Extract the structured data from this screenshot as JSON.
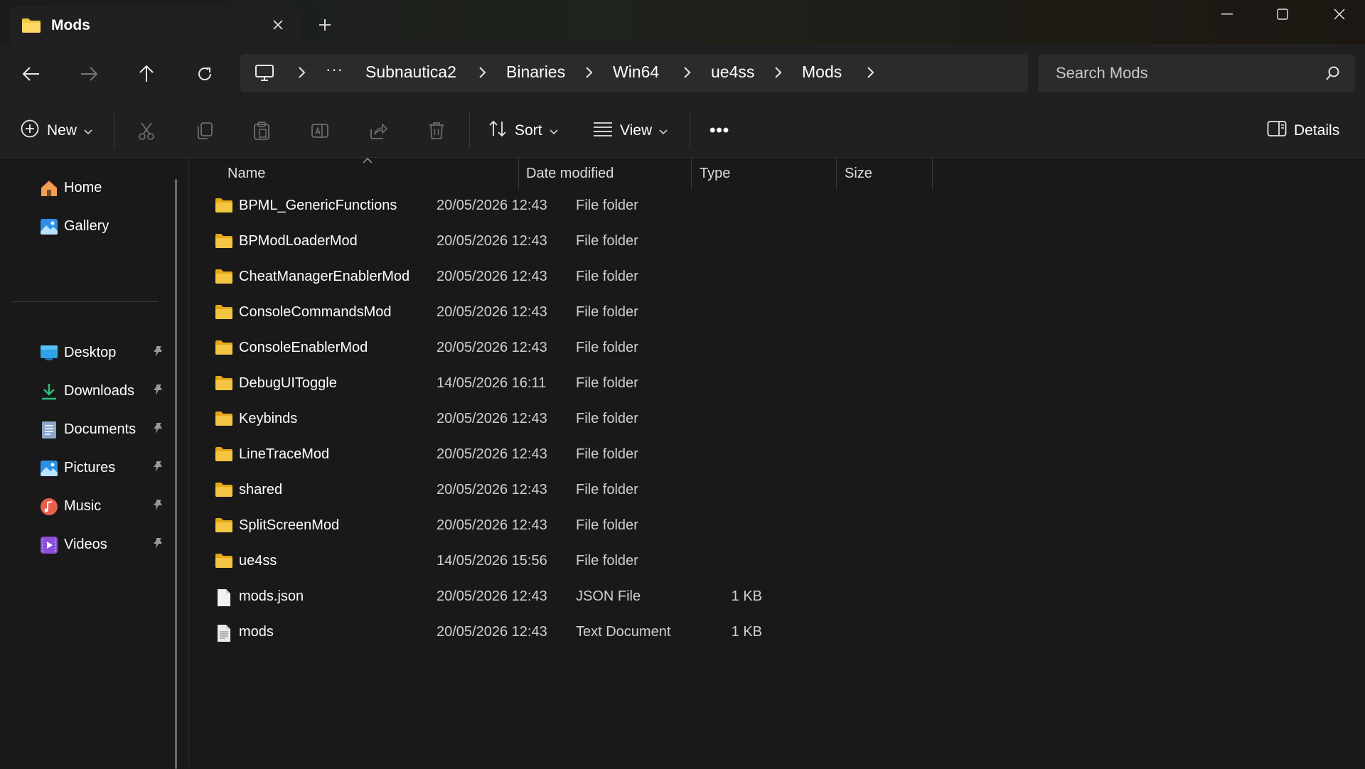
{
  "window": {
    "tab_title": "Mods",
    "icons": {
      "folder": "folder-icon",
      "close": "close-icon",
      "new_tab": "plus-icon",
      "minimize": "minimize-icon",
      "maximize": "maximize-icon"
    }
  },
  "nav": {
    "back": "arrow-left-icon",
    "forward": "arrow-right-icon",
    "up": "arrow-up-icon",
    "refresh": "refresh-icon"
  },
  "address": {
    "overflow": "···",
    "crumbs": [
      "Subnautica2",
      "Binaries",
      "Win64",
      "ue4ss",
      "Mods"
    ]
  },
  "search": {
    "placeholder": "Search Mods"
  },
  "commands": {
    "new_label": "New",
    "sort_label": "Sort",
    "view_label": "View",
    "more": "•••",
    "details_label": "Details"
  },
  "sidebar": {
    "top": [
      {
        "label": "Home",
        "icon": "home-icon"
      },
      {
        "label": "Gallery",
        "icon": "gallery-icon"
      }
    ],
    "pinned": [
      {
        "label": "Desktop",
        "icon": "desktop-icon"
      },
      {
        "label": "Downloads",
        "icon": "download-icon"
      },
      {
        "label": "Documents",
        "icon": "document-icon"
      },
      {
        "label": "Pictures",
        "icon": "pictures-icon"
      },
      {
        "label": "Music",
        "icon": "music-icon"
      },
      {
        "label": "Videos",
        "icon": "videos-icon"
      }
    ]
  },
  "columns": {
    "name": "Name",
    "date": "Date modified",
    "type": "Type",
    "size": "Size"
  },
  "files": [
    {
      "name": "BPML_GenericFunctions",
      "date": "20/05/2026 12:43",
      "type": "File folder",
      "size": "",
      "kind": "folder"
    },
    {
      "name": "BPModLoaderMod",
      "date": "20/05/2026 12:43",
      "type": "File folder",
      "size": "",
      "kind": "folder"
    },
    {
      "name": "CheatManagerEnablerMod",
      "date": "20/05/2026 12:43",
      "type": "File folder",
      "size": "",
      "kind": "folder"
    },
    {
      "name": "ConsoleCommandsMod",
      "date": "20/05/2026 12:43",
      "type": "File folder",
      "size": "",
      "kind": "folder"
    },
    {
      "name": "ConsoleEnablerMod",
      "date": "20/05/2026 12:43",
      "type": "File folder",
      "size": "",
      "kind": "folder"
    },
    {
      "name": "DebugUIToggle",
      "date": "14/05/2026 16:11",
      "type": "File folder",
      "size": "",
      "kind": "folder"
    },
    {
      "name": "Keybinds",
      "date": "20/05/2026 12:43",
      "type": "File folder",
      "size": "",
      "kind": "folder"
    },
    {
      "name": "LineTraceMod",
      "date": "20/05/2026 12:43",
      "type": "File folder",
      "size": "",
      "kind": "folder"
    },
    {
      "name": "shared",
      "date": "20/05/2026 12:43",
      "type": "File folder",
      "size": "",
      "kind": "folder"
    },
    {
      "name": "SplitScreenMod",
      "date": "20/05/2026 12:43",
      "type": "File folder",
      "size": "",
      "kind": "folder"
    },
    {
      "name": "ue4ss",
      "date": "14/05/2026 15:56",
      "type": "File folder",
      "size": "",
      "kind": "folder"
    },
    {
      "name": "mods.json",
      "date": "20/05/2026 12:43",
      "type": "JSON File",
      "size": "1 KB",
      "kind": "file"
    },
    {
      "name": "mods",
      "date": "20/05/2026 12:43",
      "type": "Text Document",
      "size": "1 KB",
      "kind": "text"
    }
  ],
  "colors": {
    "folder": "#f4c542",
    "accent": "#60cdff",
    "bg": "#191919"
  }
}
